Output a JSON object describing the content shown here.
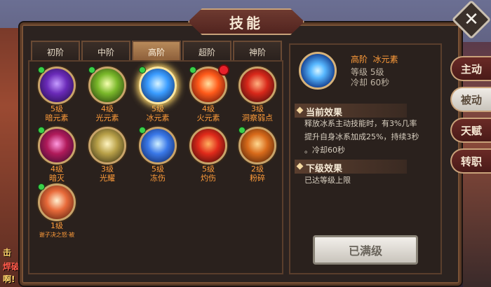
{
  "title": "技能",
  "tabs": [
    "初阶",
    "中阶",
    "高阶",
    "超阶",
    "神阶"
  ],
  "active_tab": 2,
  "skills": [
    {
      "level": "5级",
      "name": "暗元素",
      "colors": [
        "#c59cff",
        "#6a2ab8",
        "#1a0a3a"
      ],
      "green_dot": true
    },
    {
      "level": "4级",
      "name": "光元素",
      "colors": [
        "#f6ffb0",
        "#7ab82a",
        "#1a2a0a"
      ],
      "green_dot": true
    },
    {
      "level": "5级",
      "name": "冰元素",
      "colors": [
        "#d8f4ff",
        "#3a9cff",
        "#0a1a4a"
      ],
      "green_dot": true,
      "selected": true
    },
    {
      "level": "4级",
      "name": "火元素",
      "colors": [
        "#ffe0a0",
        "#ff5a1a",
        "#4a0a0a"
      ],
      "green_dot": true,
      "red_dot": true
    },
    {
      "level": "3级",
      "name": "洞察弱点",
      "colors": [
        "#ffb080",
        "#d8281a",
        "#2a0a0a"
      ],
      "green_dot": false
    },
    {
      "level": "4级",
      "name": "暗灭",
      "colors": [
        "#ff9ae0",
        "#b01a5a",
        "#2a0a2a"
      ],
      "green_dot": true
    },
    {
      "level": "3级",
      "name": "光耀",
      "colors": [
        "#fff4c0",
        "#b8a048",
        "#2a2410"
      ],
      "green_dot": false
    },
    {
      "level": "5级",
      "name": "冻伤",
      "colors": [
        "#d0f0ff",
        "#3a78e8",
        "#0a1a4a"
      ],
      "green_dot": true
    },
    {
      "level": "5级",
      "name": "灼伤",
      "colors": [
        "#ffb060",
        "#e02a1a",
        "#2a0808"
      ],
      "green_dot": false
    },
    {
      "level": "2级",
      "name": "粉碎",
      "colors": [
        "#ffd890",
        "#d86a1a",
        "#3a1808"
      ],
      "green_dot": true
    },
    {
      "level": "1级",
      "name": "谢子决之怒·被",
      "colors": [
        "#fff0d0",
        "#e86a3a",
        "#4a1a0a"
      ],
      "green_dot": true
    }
  ],
  "detail": {
    "tier": "高阶",
    "element": "冰元素",
    "level_line": "等级 5级",
    "cooldown_line": "冷却 60秒",
    "current_effect_title": "当前效果",
    "current_effect_lines": [
      "释放冰系主动技能时，有3%几率",
      "提升自身冰系加成25%，持续3秒",
      "。冷却60秒"
    ],
    "next_effect_title": "下级效果",
    "next_effect_text": "已达等级上限",
    "maxed_button": "已满级"
  },
  "side_nav": [
    "主动",
    "被动",
    "天赋",
    "转职"
  ],
  "side_nav_active": 1,
  "left_edge_texts": [
    "击",
    "焊破",
    "啊!"
  ]
}
